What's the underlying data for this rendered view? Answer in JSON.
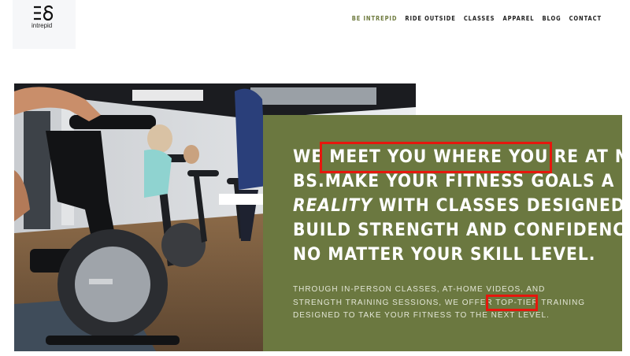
{
  "logo": {
    "wordmark": "intrepid"
  },
  "nav": {
    "items": [
      {
        "label": "BE INTREPID",
        "active": true
      },
      {
        "label": "RIDE OUTSIDE"
      },
      {
        "label": "CLASSES"
      },
      {
        "label": "APPAREL"
      },
      {
        "label": "BLOG"
      },
      {
        "label": "CONTACT"
      }
    ]
  },
  "hero": {
    "headline_lines": [
      "WE MEET YOU WHERE YOU'RE AT NO",
      "BS.MAKE YOUR FITNESS GOALS A",
      "WITH CLASSES DESIGNED TO",
      "BUILD STRENGTH AND CONFIDENCE,",
      "NO MATTER YOUR SKILL LEVEL."
    ],
    "headline_emphasis": "REALITY",
    "body_lines": [
      "THROUGH IN-PERSON CLASSES, AT-HOME VIDEOS, AND",
      "STRENGTH TRAINING SESSIONS, WE OFFER TOP-TIER TRAINING",
      "DESIGNED TO TAKE YOUR FITNESS TO THE NEXT LEVEL."
    ]
  },
  "colors": {
    "panel_green": "#6b7840",
    "nav_active": "#6e7a3e",
    "highlight_red": "#e6170d"
  }
}
